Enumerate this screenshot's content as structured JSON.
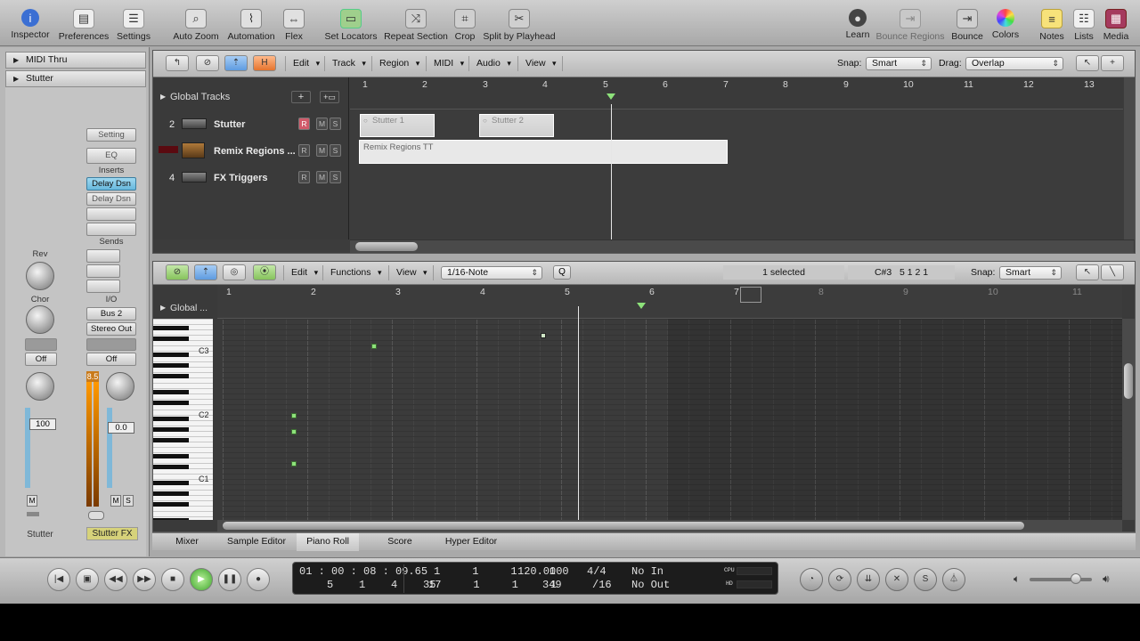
{
  "toolbar": {
    "left": [
      {
        "label": "Inspector",
        "icon": "info-icon"
      },
      {
        "label": "Preferences",
        "icon": "preferences-icon"
      },
      {
        "label": "Settings",
        "icon": "settings-icon"
      },
      {
        "label": "Auto Zoom",
        "icon": "auto-zoom-icon"
      },
      {
        "label": "Automation",
        "icon": "automation-icon"
      },
      {
        "label": "Flex",
        "icon": "flex-icon"
      },
      {
        "label": "Set Locators",
        "icon": "set-locators-icon"
      },
      {
        "label": "Repeat Section",
        "icon": "repeat-section-icon"
      },
      {
        "label": "Crop",
        "icon": "crop-icon"
      },
      {
        "label": "Split by Playhead",
        "icon": "split-icon"
      }
    ],
    "right": [
      {
        "label": "Learn",
        "icon": "learn-icon"
      },
      {
        "label": "Bounce Regions",
        "icon": "bounce-regions-icon"
      },
      {
        "label": "Bounce",
        "icon": "bounce-icon"
      },
      {
        "label": "Colors",
        "icon": "colors-icon"
      },
      {
        "label": "Notes",
        "icon": "notes-icon"
      },
      {
        "label": "Lists",
        "icon": "lists-icon"
      },
      {
        "label": "Media",
        "icon": "media-icon"
      }
    ]
  },
  "inspector": {
    "rows": [
      "MIDI Thru",
      "Stutter"
    ],
    "strip_left": {
      "sends_labels": [
        "Rev",
        "Chor"
      ],
      "off": "Off",
      "volume": "100",
      "m": "M",
      "name": "Stutter"
    },
    "strip_right": {
      "setting": "Setting",
      "eq": "EQ",
      "inserts_label": "Inserts",
      "inserts": [
        "Delay Dsn",
        "Delay Dsn"
      ],
      "sends_label": "Sends",
      "io_label": "I/O",
      "input": "Bus 2",
      "output": "Stereo Out",
      "off": "Off",
      "meter_peak": "8.5",
      "volume": "0.0",
      "m": "M",
      "s": "S",
      "name": "Stutter FX"
    }
  },
  "arrange": {
    "menus": [
      "Edit",
      "Track",
      "Region",
      "MIDI",
      "Audio",
      "View"
    ],
    "snap_label": "Snap:",
    "snap_value": "Smart",
    "drag_label": "Drag:",
    "drag_value": "Overlap",
    "global_tracks": "Global Tracks",
    "ruler": [
      "1",
      "2",
      "3",
      "4",
      "5",
      "6",
      "7",
      "8",
      "9",
      "10",
      "11",
      "12",
      "13"
    ],
    "tracks": [
      {
        "num": "2",
        "name": "Stutter",
        "r": "R",
        "m": "M",
        "s": "S"
      },
      {
        "num": "",
        "name": "Remix Regions ...",
        "r": "R",
        "m": "M",
        "s": "S"
      },
      {
        "num": "4",
        "name": "FX Triggers",
        "r": "R",
        "m": "M",
        "s": "S"
      }
    ],
    "regions": [
      "Stutter 1",
      "Stutter 2",
      "Remix Regions TT"
    ]
  },
  "piano_roll": {
    "menus": [
      "Edit",
      "Functions",
      "View"
    ],
    "quantize": "1/16-Note",
    "q_button": "Q",
    "selected": "1 selected",
    "position": "C#3   5 1 2 1",
    "snap_label": "Snap:",
    "snap_value": "Smart",
    "global": "Global ...",
    "ruler": [
      "1",
      "2",
      "3",
      "4",
      "5",
      "6",
      "7",
      "8",
      "9",
      "10",
      "11"
    ],
    "key_labels": [
      "C3",
      "C2",
      "C1"
    ]
  },
  "bottom_tabs": [
    "Mixer",
    "Sample Editor",
    "Piano Roll",
    "Score",
    "Hyper Editor"
  ],
  "transport": {
    "smpte": "01 : 00 : 08 : 09.65",
    "bars": "5    1    4    35",
    "loc1": "1     1     1     1",
    "loc2": "17     1     1     1",
    "tempo": "120.0000",
    "division": "349",
    "sig": "4/4",
    "sig2": "/16",
    "in": "No In",
    "out": "No Out",
    "cpu": "CPU",
    "hd": "HD"
  }
}
